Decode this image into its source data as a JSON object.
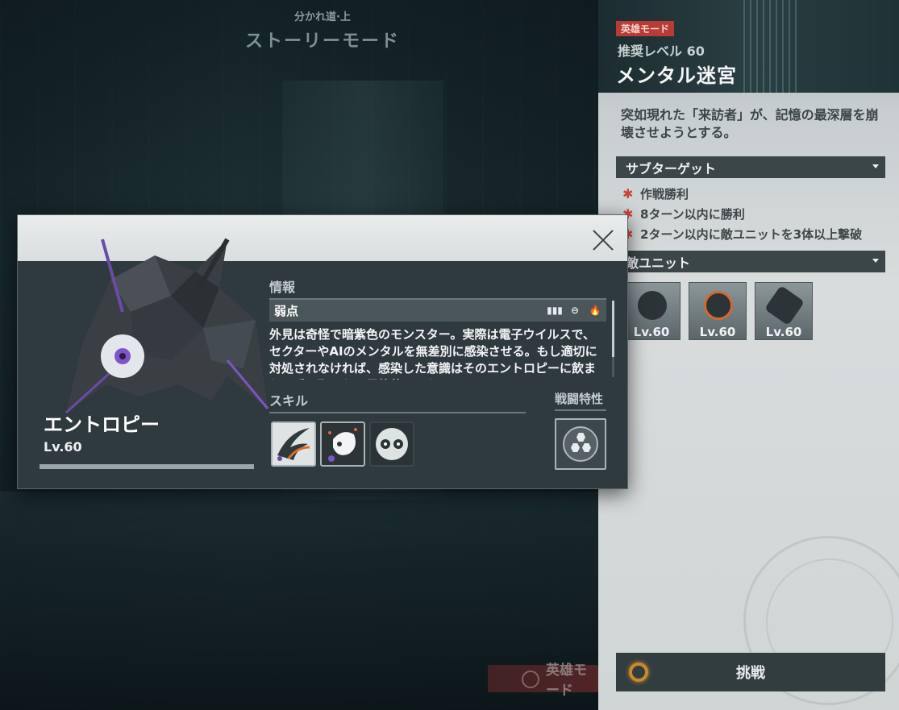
{
  "background": {
    "story_subtitle": "分かれ道·上",
    "story_title": "ストーリーモード",
    "bottom_mode_tab": "英雄モード"
  },
  "stage": {
    "mode_badge": "英雄モード",
    "recommended_level": "推奨レベル 60",
    "name": "メンタル迷宮",
    "description": "突如現れた「来訪者」が、記憶の最深層を崩壊させようとする。",
    "subtarget_header": "サブターゲット",
    "subtargets": [
      "作戦勝利",
      "8ターン以内に勝利",
      "2ターン以内に敵ユニットを3体以上撃破"
    ],
    "enemy_header": "敵ユニット",
    "enemies": [
      {
        "level": "Lv.60"
      },
      {
        "level": "Lv.60"
      },
      {
        "level": "Lv.60"
      }
    ],
    "challenge_label": "挑戦",
    "accent_color": "#b83b35"
  },
  "modal": {
    "monster_name": "エントロピー",
    "monster_level": "Lv.60",
    "info_header": "情報",
    "weakness_label": "弱点",
    "weakness_icons": [
      "pierce-icon",
      "ranged-icon",
      "fire-icon"
    ],
    "description": "外見は奇怪で暗紫色のモンスター。実際は電子ウイルスで、セクターやAIのメンタルを無差別に感染させる。もし適切に対処されなければ、感染した意識はそのエントロピーに飲まれ、乗っ取られ、最終的にそれ",
    "skill_header": "スキル",
    "trait_header": "戦闘特性",
    "skills": [
      "slash-skill-icon",
      "splatter-skill-icon",
      "eyes-skill-icon"
    ],
    "trait": "hexagon-cluster-icon"
  }
}
